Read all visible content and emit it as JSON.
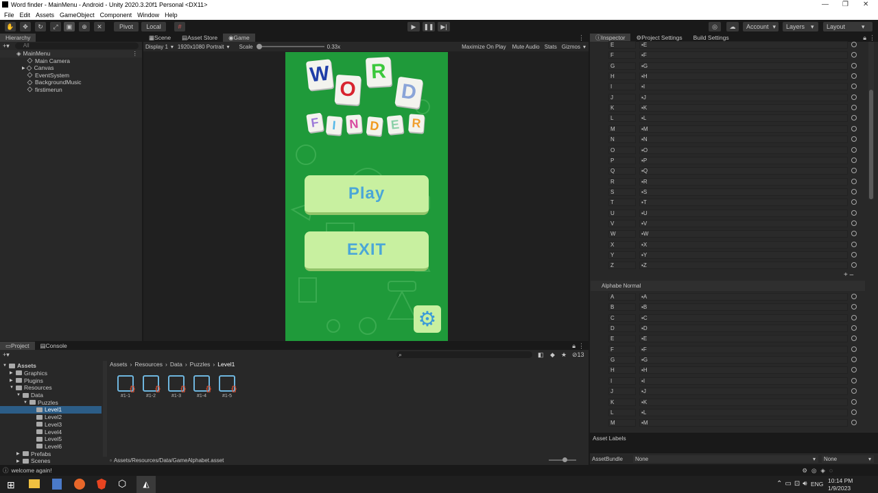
{
  "window": {
    "title": "Word finder - MainMenu - Android - Unity 2020.3.20f1 Personal <DX11>",
    "minimize": "—",
    "maximize": "❐",
    "close": "✕"
  },
  "menu": [
    "File",
    "Edit",
    "Assets",
    "GameObject",
    "Component",
    "Window",
    "Help"
  ],
  "toolbar": {
    "pivot": "Pivot",
    "local": "Local",
    "account": "Account",
    "layers": "Layers",
    "layout": "Layout"
  },
  "hierarchy": {
    "tab": "Hierarchy",
    "search": "All",
    "scene": "MainMenu",
    "items": [
      "Main Camera",
      "Canvas",
      "EventSystem",
      "BackgroundMusic",
      "firstimerun"
    ]
  },
  "game": {
    "tabs": [
      "Scene",
      "Asset Store",
      "Game"
    ],
    "display": "Display 1",
    "resolution": "1920x1080 Portrait",
    "scale_label": "Scale",
    "scale_value": "0.33x",
    "options": [
      "Maximize On Play",
      "Mute Audio",
      "Stats",
      "Gizmos"
    ],
    "word_letters": [
      "W",
      "O",
      "R",
      "D"
    ],
    "finder_letters": [
      "F",
      "I",
      "N",
      "D",
      "E",
      "R"
    ],
    "play": "Play",
    "exit": "EXIT",
    "settings_icon": "gear-icon"
  },
  "inspector": {
    "tabs": [
      "Inspector",
      "Project Settings",
      "Build Settings"
    ],
    "upper_rows": [
      "E",
      "F",
      "G",
      "H",
      "I",
      "J",
      "K",
      "L",
      "M",
      "N",
      "O",
      "P",
      "Q",
      "R",
      "S",
      "T",
      "U",
      "V",
      "W",
      "X",
      "Y",
      "Z"
    ],
    "section_title": "Alphabe Normal",
    "lower_rows": [
      "A",
      "B",
      "C",
      "D",
      "E",
      "F",
      "G",
      "H",
      "I",
      "J",
      "K",
      "L",
      "M"
    ],
    "asset_labels": "Asset Labels",
    "asset_bundle": "AssetBundle",
    "bundle_value": "None",
    "variant_value": "None"
  },
  "project": {
    "tabs": [
      "Project",
      "Console"
    ],
    "count": "13",
    "tree": [
      "Assets",
      "Graphics",
      "Plugins",
      "Resources",
      "Data",
      "Puzzles",
      "Level1",
      "Level2",
      "Level3",
      "Level4",
      "Level5",
      "Level6",
      "Prefabs",
      "Scenes"
    ],
    "breadcrumb": [
      "Assets",
      "Resources",
      "Data",
      "Puzzles",
      "Level1"
    ],
    "assets": [
      "#1-1",
      "#1-2",
      "#1-3",
      "#1-4",
      "#1-5"
    ],
    "path": "Assets/Resources/Data/GameAlphabet.asset"
  },
  "status": "welcome again!",
  "taskbar": {
    "lang": "ENG",
    "time": "10:14 PM",
    "date": "1/9/2023"
  },
  "colors": {
    "accent": "#2c5d87",
    "game_green": "#1f9a3a"
  }
}
